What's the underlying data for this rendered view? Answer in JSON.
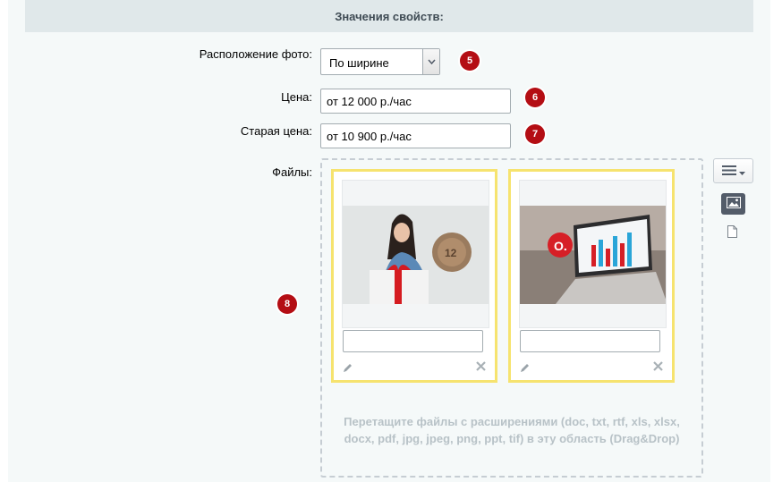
{
  "section": {
    "title": "Значения свойств:"
  },
  "fields": {
    "photo_layout": {
      "label": "Расположение фото:",
      "value": "По ширине",
      "badge": "5"
    },
    "price": {
      "label": "Цена:",
      "value": "от 12 000 р./час",
      "badge": "6"
    },
    "old_price": {
      "label": "Старая цена:",
      "value": "от 10 900 р./час",
      "badge": "7"
    },
    "files": {
      "label": "Файлы:",
      "badge": "8",
      "items": [
        {
          "image": "woman-with-gift-photo",
          "description": ""
        },
        {
          "image": "laptop-chart-photo",
          "description": ""
        }
      ],
      "drop_hint": "Перетащите файлы с расширениями (doc, txt, rtf, xls, xlsx, docx, pdf, jpg, jpeg, png, ppt, tif) в эту область (Drag&Drop)"
    }
  },
  "view_toggle": {
    "menu_icon": "hamburger-icon",
    "image_view_icon": "image-icon",
    "file_view_icon": "file-icon"
  },
  "colors": {
    "badge": "#b40e14",
    "card_border": "#f6e36f",
    "header_bg": "#e0e8ea"
  }
}
